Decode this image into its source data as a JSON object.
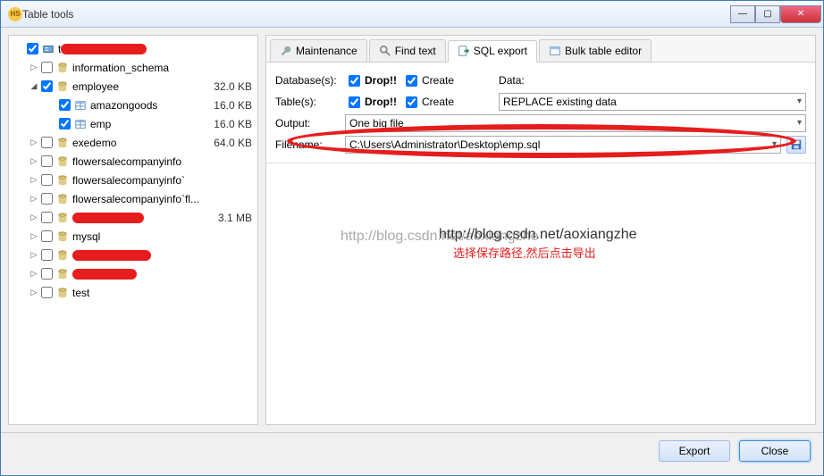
{
  "window": {
    "title": "Table tools"
  },
  "winbtns": {
    "min": "—",
    "max": "▢",
    "close": "✕"
  },
  "tree": [
    {
      "level": 1,
      "exp": "",
      "checked": true,
      "partial": true,
      "icon": "server",
      "label_redact_w": 96,
      "label": "t",
      "size": ""
    },
    {
      "level": 2,
      "exp": "▷",
      "checked": false,
      "icon": "db",
      "label": "information_schema",
      "size": ""
    },
    {
      "level": 2,
      "exp": "◢",
      "checked": true,
      "icon": "db",
      "label": "employee",
      "size": "32.0 KB"
    },
    {
      "level": 3,
      "exp": "",
      "checked": true,
      "icon": "tbl",
      "label": "amazongoods",
      "size": "16.0 KB"
    },
    {
      "level": 3,
      "exp": "",
      "checked": true,
      "icon": "tbl",
      "label": "emp",
      "size": "16.0 KB"
    },
    {
      "level": 2,
      "exp": "▷",
      "checked": false,
      "icon": "db",
      "label": "exedemo",
      "size": "64.0 KB"
    },
    {
      "level": 2,
      "exp": "▷",
      "checked": false,
      "icon": "db",
      "label": "flowersalecompanyinfo",
      "size": ""
    },
    {
      "level": 2,
      "exp": "▷",
      "checked": false,
      "icon": "db",
      "label": "flowersalecompanyinfo`",
      "size": ""
    },
    {
      "level": 2,
      "exp": "▷",
      "checked": false,
      "icon": "db",
      "label": "flowersalecompanyinfo`fl...",
      "size": ""
    },
    {
      "level": 2,
      "exp": "▷",
      "checked": false,
      "icon": "db",
      "label_redact_w": 80,
      "size": "3.1 MB"
    },
    {
      "level": 2,
      "exp": "▷",
      "checked": false,
      "icon": "db",
      "label": "mysql",
      "size": ""
    },
    {
      "level": 2,
      "exp": "▷",
      "checked": false,
      "icon": "db",
      "label_redact_w": 88,
      "size": ""
    },
    {
      "level": 2,
      "exp": "▷",
      "checked": false,
      "icon": "db",
      "label_redact_w": 72,
      "size": ""
    },
    {
      "level": 2,
      "exp": "▷",
      "checked": false,
      "icon": "db",
      "label": "test",
      "size": ""
    }
  ],
  "tabs": [
    {
      "key": "maintenance",
      "label": "Maintenance",
      "active": false
    },
    {
      "key": "find-text",
      "label": "Find text",
      "active": false
    },
    {
      "key": "sql-export",
      "label": "SQL export",
      "active": true
    },
    {
      "key": "bulk-editor",
      "label": "Bulk table editor",
      "active": false
    }
  ],
  "form": {
    "databases_label": "Database(s):",
    "tables_label": "Table(s):",
    "output_label": "Output:",
    "filename_label": "Filename:",
    "drop_label": "Drop!!",
    "create_label": "Create",
    "data_label": "Data:",
    "db_drop": true,
    "db_create": true,
    "tbl_drop": true,
    "tbl_create": true,
    "data_option": "REPLACE existing data",
    "output_option": "One big file",
    "filename_value": "C:\\Users\\Administrator\\Desktop\\emp.sql"
  },
  "footer": {
    "export": "Export",
    "close": "Close"
  },
  "watermark": "http://blog.csdn.net/aoxiangzhe",
  "watermark2": "http://blog.csdn.net/aoxiangzhe",
  "annotation": "选择保存路径,然后点击导出"
}
